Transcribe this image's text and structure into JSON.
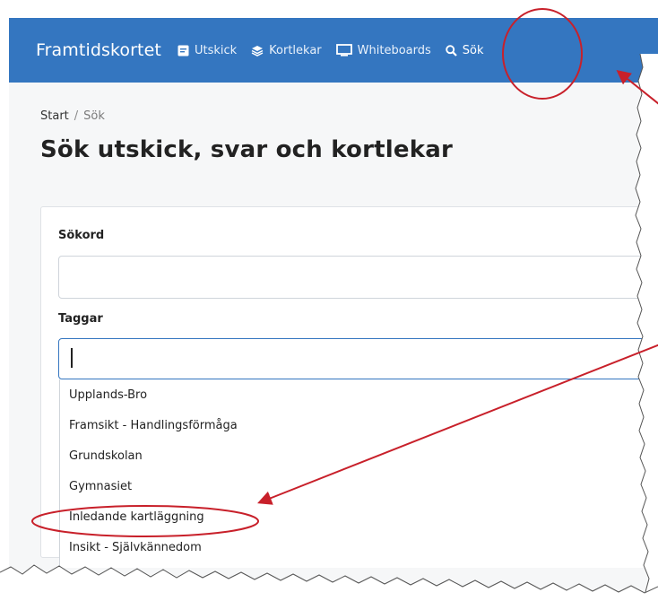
{
  "navbar": {
    "brand": "Framtidskortet",
    "links": [
      {
        "label": "Utskick",
        "icon": "newsletter-icon"
      },
      {
        "label": "Kortlekar",
        "icon": "layers-icon"
      },
      {
        "label": "Whiteboards",
        "icon": "screen-icon"
      },
      {
        "label": "Sök",
        "icon": "search-icon",
        "active": true
      }
    ]
  },
  "breadcrumb": {
    "home": "Start",
    "separator": "/",
    "current": "Sök"
  },
  "page": {
    "title": "Sök utskick, svar och kortlekar"
  },
  "form": {
    "keyword_label": "Sökord",
    "keyword_value": "",
    "tags_label": "Taggar",
    "tags_value": ""
  },
  "dropdown": {
    "options": [
      "Upplands-Bro",
      "Framsikt - Handlingsförmåga",
      "Grundskolan",
      "Gymnasiet",
      "Inledande kartläggning",
      "Insikt - Självkännedom"
    ]
  },
  "colors": {
    "navbar": "#3476c0",
    "annotation": "#c8202a",
    "focus": "#3476c0"
  }
}
